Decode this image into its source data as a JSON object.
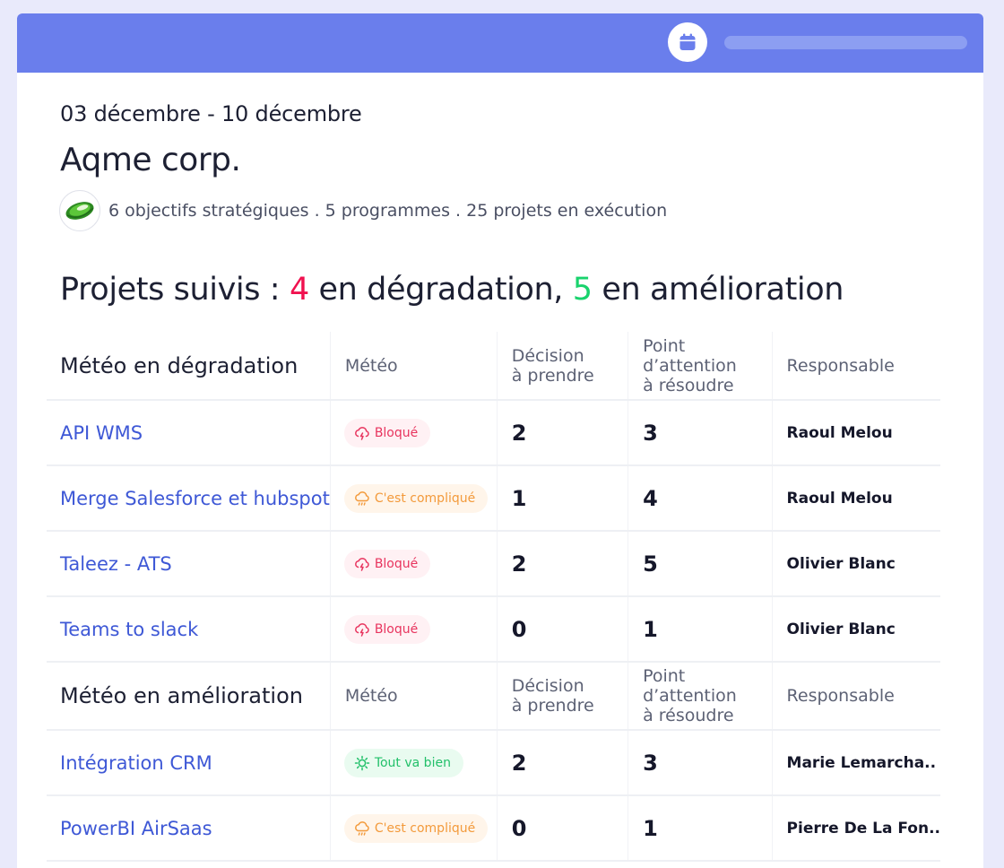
{
  "header": {
    "calendar_icon": "calendar-icon",
    "colors": {
      "bar": "#6a7eec",
      "pill": "#8c9ef2"
    }
  },
  "overview": {
    "date_range": "03 décembre - 10 décembre",
    "company": "Aqme corp.",
    "summary": "6 objectifs stratégiques . 5 programmes . 25 projets en exécution"
  },
  "headline": {
    "prefix": "Projets suivis : ",
    "degradation_count": "4",
    "degradation_text": " en dégradation, ",
    "improvement_count": "5",
    "improvement_text": " en amélioration"
  },
  "columns": {
    "meteo": "Météo",
    "decision_line1": "Décision",
    "decision_line2": "à prendre",
    "point_line1": "Point",
    "point_line2": "d’attention",
    "point_line3": "à résoudre",
    "owner": "Responsable"
  },
  "sections": {
    "degradation_title": "Météo en dégradation",
    "improvement_title": "Météo en amélioration"
  },
  "badges": {
    "blocked": "Bloqué",
    "complicated": "C'est compliqué",
    "good": "Tout va bien"
  },
  "degradation_rows": [
    {
      "name": "API WMS",
      "weather": "Bloqué",
      "decisions": "2",
      "points": "3",
      "owner": "Raoul Melou"
    },
    {
      "name": "Merge Salesforce et hubspot",
      "weather": "C'est compliqué",
      "decisions": "1",
      "points": "4",
      "owner": "Raoul Melou"
    },
    {
      "name": "Taleez - ATS",
      "weather": "Bloqué",
      "decisions": "2",
      "points": "5",
      "owner": "Olivier Blanc"
    },
    {
      "name": "Teams to slack",
      "weather": "Bloqué",
      "decisions": "0",
      "points": "1",
      "owner": "Olivier Blanc"
    }
  ],
  "improvement_rows": [
    {
      "name": "Intégration CRM",
      "weather": "Tout va bien",
      "decisions": "2",
      "points": "3",
      "owner": "Marie Lemarcha.."
    },
    {
      "name": "PowerBI AirSaas",
      "weather": "C'est compliqué",
      "decisions": "0",
      "points": "1",
      "owner": "Pierre De La Fon.."
    }
  ],
  "status_colors": {
    "blocked": "#e8345e",
    "complicated": "#f39a3b",
    "good": "#22c06a",
    "link": "#3e58d6",
    "degradation": "#f0114f",
    "improvement": "#19d36d"
  }
}
